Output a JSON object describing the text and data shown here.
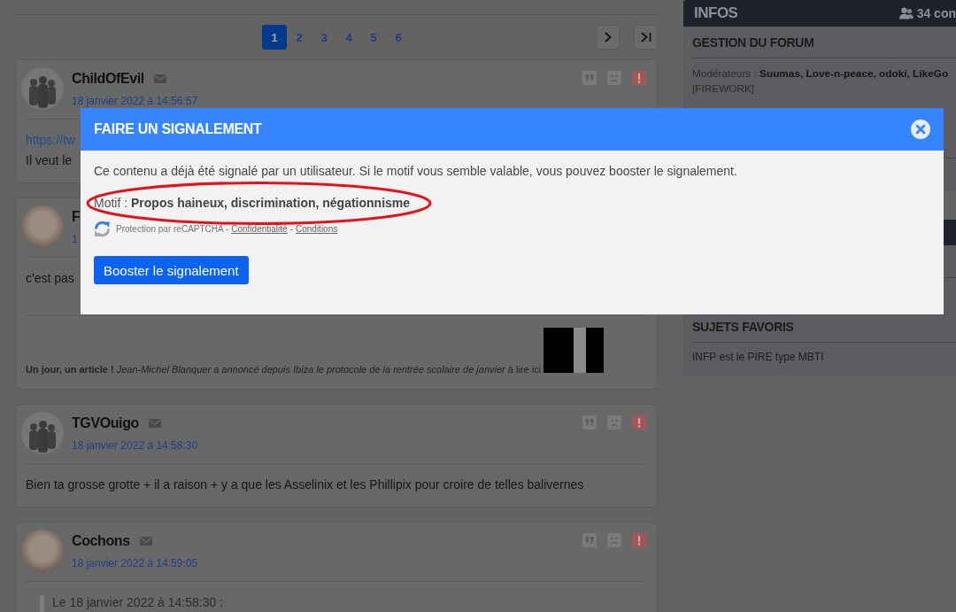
{
  "pagination": {
    "pages": [
      {
        "label": "1",
        "selected": true
      },
      {
        "label": "2",
        "selected": false
      },
      {
        "label": "3",
        "selected": false
      },
      {
        "label": "4",
        "selected": false
      },
      {
        "label": "5",
        "selected": false
      },
      {
        "label": "6",
        "selected": false
      }
    ]
  },
  "posts": [
    {
      "author": "ChildOfEvil",
      "date": "18 janvier 2022 à 14:56:57",
      "avatar": {
        "kind": "silhouette"
      },
      "icons": true,
      "body": [
        {
          "kind": "link",
          "text": "https://tw"
        },
        {
          "kind": "text",
          "text": "Il veut le"
        }
      ]
    },
    {
      "author": "F",
      "date": "1",
      "avatar": {
        "kind": "photo"
      },
      "icons": false,
      "body": [
        {
          "kind": "text",
          "text": "c'est pas"
        }
      ],
      "signature": {
        "text": "**Un jour, un article !** *Jean-Michel Blanquer a annoncé depuis Ibiza le protocole de la rentrée scolaire de janvier* à lire ici",
        "image": true
      }
    },
    {
      "author": "TGVOuigo",
      "date": "18 janvier 2022 à 14:58:30",
      "avatar": {
        "kind": "silhouette"
      },
      "icons": true,
      "body": [
        {
          "kind": "text",
          "text": "Bien ta grosse grotte + il a raison + y a que les Asselinix et les Phillipix pour croire de telles balivernes"
        }
      ]
    },
    {
      "author": "Cochons",
      "date": "18 janvier 2022 à 14:59:05",
      "avatar": {
        "kind": "photo"
      },
      "icons": true,
      "quote": {
        "header": "Le 18 janvier 2022 à 14:58:30 :"
      }
    }
  ],
  "sidebar": {
    "panels": [
      {
        "title": "INFOS",
        "online": "34 con",
        "sections": [
          {
            "title": "GESTION DU FORUM",
            "lines": [
              "Modérateurs : **Suumas, Love-n-peace, odoki, LikeGo**",
              "[FIREWORK]"
            ]
          }
        ]
      },
      {
        "sections": [
          {
            "title": "SUJETS FAVORIS",
            "items": [
              "INFP est le PIRE type MBTI"
            ]
          }
        ]
      }
    ]
  },
  "modal": {
    "title": "FAIRE UN SIGNALEMENT",
    "message": "Ce contenu a déjà été signalé par un utilisateur. Si le motif vous semble valable, vous pouvez booster le signalement.",
    "reason": "Motif : **Propos haineux, discrimination, négationnisme**",
    "highlight": true,
    "captcha": [
      {
        "kind": "text",
        "text": "Protection par reCAPTCHA -"
      },
      {
        "kind": "link",
        "text": "Confidentialité"
      },
      {
        "kind": "text",
        "text": "-"
      },
      {
        "kind": "link",
        "text": "Conditions"
      }
    ],
    "button": "Booster le signalement"
  }
}
